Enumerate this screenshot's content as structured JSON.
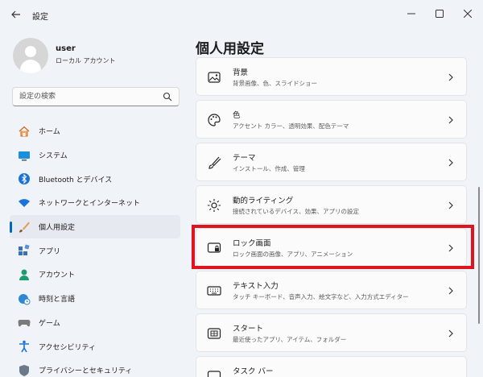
{
  "window": {
    "title": "設定"
  },
  "profile": {
    "name": "user",
    "account_type": "ローカル アカウント"
  },
  "search": {
    "placeholder": "設定の検索"
  },
  "nav": {
    "items": [
      {
        "label": "ホーム",
        "icon": "home-icon"
      },
      {
        "label": "システム",
        "icon": "monitor-icon"
      },
      {
        "label": "Bluetooth とデバイス",
        "icon": "bluetooth-icon"
      },
      {
        "label": "ネットワークとインターネット",
        "icon": "wifi-icon"
      },
      {
        "label": "個人用設定",
        "icon": "brush-icon",
        "selected": true
      },
      {
        "label": "アプリ",
        "icon": "apps-icon"
      },
      {
        "label": "アカウント",
        "icon": "person-icon"
      },
      {
        "label": "時刻と言語",
        "icon": "globe-clock-icon"
      },
      {
        "label": "ゲーム",
        "icon": "gamepad-icon"
      },
      {
        "label": "アクセシビリティ",
        "icon": "accessibility-icon"
      },
      {
        "label": "プライバシーとセキュリティ",
        "icon": "shield-icon"
      }
    ]
  },
  "main": {
    "title": "個人用設定",
    "cards": [
      {
        "title": "背景",
        "subtitle": "背景画像、色、スライドショー",
        "icon": "image-icon"
      },
      {
        "title": "色",
        "subtitle": "アクセント カラー、透明効果、配色テーマ",
        "icon": "palette-icon"
      },
      {
        "title": "テーマ",
        "subtitle": "インストール、作成、管理",
        "icon": "brush-icon"
      },
      {
        "title": "動的ライティング",
        "subtitle": "接続されているデバイス、効果、アプリの設定",
        "icon": "dynamic-lighting-icon"
      },
      {
        "title": "ロック画面",
        "subtitle": "ロック画面の画像、アプリ、アニメーション",
        "icon": "lock-screen-icon",
        "highlighted": true
      },
      {
        "title": "テキスト入力",
        "subtitle": "タッチ キーボード、音声入力、絵文字など、入力方式エディター",
        "icon": "keyboard-icon"
      },
      {
        "title": "スタート",
        "subtitle": "最近使ったアプリ、アイテム、フォルダー",
        "icon": "start-icon"
      },
      {
        "title": "タスク バー",
        "subtitle": "",
        "icon": "taskbar-icon"
      }
    ]
  },
  "colors": {
    "accent": "#0067c0",
    "highlight_border": "#e0141e",
    "background": "#f0f4f9",
    "card": "#fbfbfb"
  }
}
